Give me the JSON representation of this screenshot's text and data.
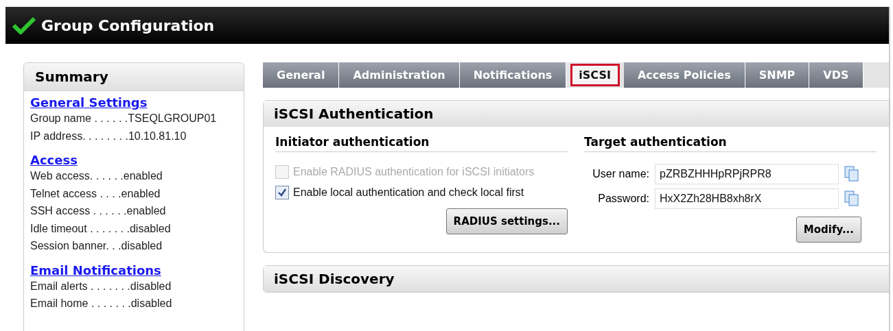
{
  "window": {
    "title": "Group Configuration"
  },
  "summary": {
    "title": "Summary",
    "sections": [
      {
        "heading": "General Settings",
        "rows": [
          {
            "label": "Group name . . . . . .",
            "value": "TSEQLGROUP01"
          },
          {
            "label": "IP address. . . . . . . .",
            "value": "10.10.81.10"
          }
        ]
      },
      {
        "heading": "Access",
        "rows": [
          {
            "label": "Web access. . . . . .",
            "value": "enabled"
          },
          {
            "label": "Telnet access . . . .",
            "value": "enabled"
          },
          {
            "label": "SSH access . . . . . .",
            "value": "enabled"
          },
          {
            "label": "Idle timeout . . . . . . .",
            "value": "disabled"
          },
          {
            "label": "Session banner. . .",
            "value": "disabled"
          }
        ]
      },
      {
        "heading": "Email Notifications",
        "rows": [
          {
            "label": "Email alerts . . . . . . .",
            "value": "disabled"
          },
          {
            "label": "Email home . . . . . . .",
            "value": "disabled"
          }
        ]
      }
    ]
  },
  "tabs": [
    {
      "label": "General",
      "selected": false
    },
    {
      "label": "Administration",
      "selected": false
    },
    {
      "label": "Notifications",
      "selected": false
    },
    {
      "label": "iSCSI",
      "selected": true
    },
    {
      "label": "Access Policies",
      "selected": false
    },
    {
      "label": "SNMP",
      "selected": false
    },
    {
      "label": "VDS",
      "selected": false
    }
  ],
  "authentication": {
    "title": "iSCSI Authentication",
    "initiator": {
      "title": "Initiator authentication",
      "options": [
        {
          "label": "Enable RADIUS authentication for iSCSI initiators",
          "checked": false,
          "disabled": true
        },
        {
          "label": "Enable local authentication and check local first",
          "checked": true,
          "disabled": false
        }
      ],
      "button": "RADIUS settings..."
    },
    "target": {
      "title": "Target authentication",
      "fields": [
        {
          "label": "User name:",
          "value": "pZRBZHHHpRPjRPR8"
        },
        {
          "label": "Password:",
          "value": "HxX2Zh28HB8xh8rX"
        }
      ],
      "button": "Modify..."
    }
  },
  "discovery": {
    "title": "iSCSI Discovery"
  }
}
